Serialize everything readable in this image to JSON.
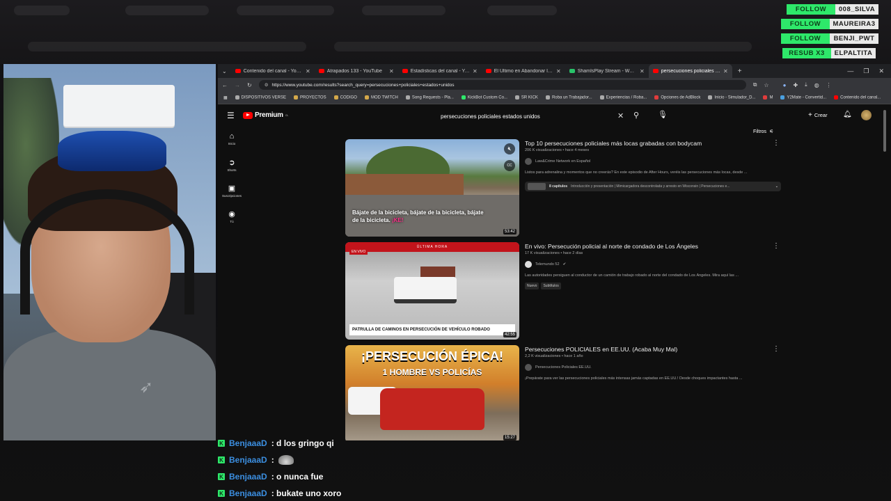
{
  "alerts": [
    {
      "tag": "FOLLOW",
      "name": "008_SILVA"
    },
    {
      "tag": "FOLLOW",
      "name": "MAUREIRA3"
    },
    {
      "tag": "FOLLOW",
      "name": "BENJI_PWT"
    },
    {
      "tag": "RESUB X3",
      "name": "ELPALTITA"
    }
  ],
  "tabs": [
    {
      "label": "Contenido del canal - YouTube"
    },
    {
      "label": "Atrapados 133 - YouTube"
    },
    {
      "label": "Estadísticas del canal - YouTube"
    },
    {
      "label": "El Último en Abandonar la Tie..."
    },
    {
      "label": "ShamIsPlay Stream - Watch Li..."
    },
    {
      "label": "persecuciones policiales estad..."
    }
  ],
  "address": {
    "url": "https://www.youtube.com/results?search_query=persecuciones+policiales+estados+unidos"
  },
  "bookmarks": [
    "DISPOSITIVOS VERSE",
    "PROYECTOS",
    "CODIGO",
    "MOD TWITCH",
    "Song Requests - Pla...",
    "KickBot Custom Co...",
    "SR KICK",
    "Roba un Trabajador...",
    "Experiencias / Roba...",
    "Opciones de AdBlock",
    "Inicio - Simulador_D...",
    "M",
    "Y2Mate - Convertid...",
    "Contenido del canal..."
  ],
  "yt": {
    "logo": "Premium",
    "logo_sup": "CL",
    "search_value": "persecuciones policiales estados unidos",
    "create_label": "Crear",
    "filters_label": "Filtros",
    "sidebar": [
      {
        "icon": "⌂",
        "label": "Inicio"
      },
      {
        "icon": "➲",
        "label": "Shorts"
      },
      {
        "icon": "▣",
        "label": "Suscripciones"
      },
      {
        "icon": "◉",
        "label": "Tú"
      }
    ]
  },
  "results": [
    {
      "title": "Top 10 persecuciones policiales más locas grabadas con bodycam",
      "sub": "206 K visualizaciones • hace 4 meses",
      "channel": "Law&Crime Network en Español",
      "desc": "Listos para adrenalina y momentos que no creerás? En este episodio de After Hours, veréis las persecuciones más locas, desde ...",
      "chapters_count": "8 capítulos",
      "chapters_text": "Introducción y presentación | Mimicargadora descontrolada y arresto en Wisconsin | Persecuciones e...",
      "duration": "53:42",
      "caption_white": "Bájate de la bicicleta, bájate de la bicicleta, bájate de la bicicleta.",
      "caption_pink": "¡KE!"
    },
    {
      "title": "En vivo: Persecución policial al norte de condado de Los Ángeles",
      "sub": "17 K visualizaciones • hace 2 días",
      "channel": "Telemundo 52",
      "desc": "Las autoridades persiguen al conductor de un camión de trabajo robado al norte del condado de Los Ángeles. Mira aquí las ...",
      "badges": [
        "Nuevo",
        "Subtítulos"
      ],
      "duration": "42:55",
      "banner": "ÚLTIMA HORA",
      "live": "EN VIVO",
      "lower_third": "PATRULLA DE CAMINOS EN PERSECUCIÓN DE VEHÍCULO ROBADO"
    },
    {
      "title": "Persecuciones POLICIALES en EE.UU. (Acaba Muy Mal)",
      "sub": "2,2 K visualizaciones • hace 1 año",
      "channel": "Persecuciones Policiales EE.UU.",
      "desc": "¡Prepárate para ver las persecuciones policiales más intensas jamás captadas en EE.UU.! Desde choques impactantes hasta ...",
      "duration": "15:27",
      "headline1": "¡PERSECUCIÓN ÉPICA!",
      "headline2": "1 HOMBRE VS POLICÍAS"
    }
  ],
  "chat": [
    {
      "user": "BenjaaaD",
      "text": ": d los gringo qi"
    },
    {
      "user": "BenjaaaD",
      "text": ":"
    },
    {
      "user": "BenjaaaD",
      "text": ": o nunca fue"
    },
    {
      "user": "BenjaaaD",
      "text": ": bukate uno xoro"
    }
  ],
  "colors": {
    "accent_follow": "#2ee86a",
    "yt_red": "#ff0000",
    "chat_user": "#3b8ee0"
  }
}
